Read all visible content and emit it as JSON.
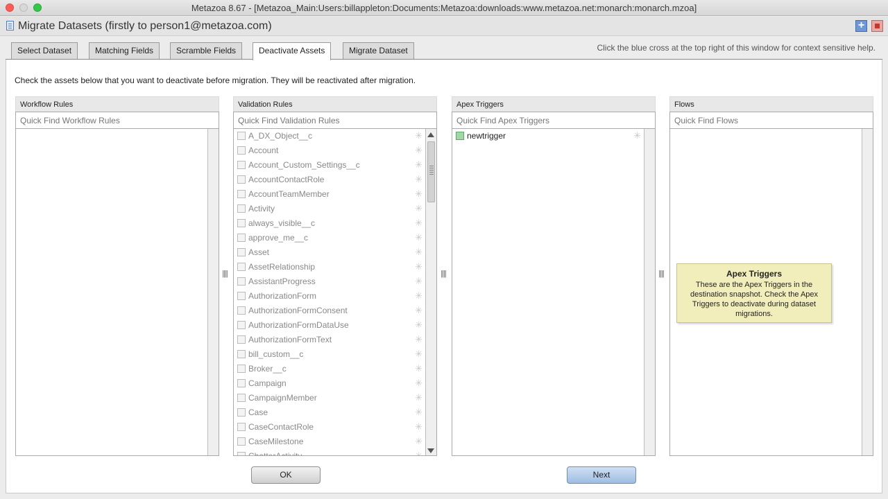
{
  "window": {
    "title": "Metazoa 8.67 - [Metazoa_Main:Users:billappleton:Documents:Metazoa:downloads:www.metazoa.net:monarch:monarch.mzoa]"
  },
  "dialog": {
    "title": "Migrate Datasets (firstly to person1@metazoa.com)",
    "help_button": "+"
  },
  "tabs": [
    {
      "label": "Select Dataset",
      "active": false
    },
    {
      "label": "Matching Fields",
      "active": false
    },
    {
      "label": "Scramble Fields",
      "active": false
    },
    {
      "label": "Deactivate Assets",
      "active": true
    },
    {
      "label": "Migrate Dataset",
      "active": false
    }
  ],
  "help_hint": "Click the blue cross at the top right of this window for context sensitive help.",
  "instructions": "Check the assets below that you want to deactivate before migration. They will be reactivated after migration.",
  "panels": {
    "workflow": {
      "title": "Workflow Rules",
      "placeholder": "Quick Find Workflow Rules"
    },
    "validation": {
      "title": "Validation Rules",
      "placeholder": "Quick Find Validation Rules",
      "items": [
        "A_DX_Object__c",
        "Account",
        "Account_Custom_Settings__c",
        "AccountContactRole",
        "AccountTeamMember",
        "Activity",
        "always_visible__c",
        "approve_me__c",
        "Asset",
        "AssetRelationship",
        "AssistantProgress",
        "AuthorizationForm",
        "AuthorizationFormConsent",
        "AuthorizationFormDataUse",
        "AuthorizationFormText",
        "bill_custom__c",
        "Broker__c",
        "Campaign",
        "CampaignMember",
        "Case",
        "CaseContactRole",
        "CaseMilestone",
        "ChatterActivity"
      ]
    },
    "apex": {
      "title": "Apex Triggers",
      "placeholder": "Quick Find Apex Triggers",
      "items": [
        "newtrigger"
      ]
    },
    "flows": {
      "title": "Flows",
      "placeholder": "Quick Find Flows"
    }
  },
  "tooltip": {
    "title": "Apex Triggers",
    "body": "These are the Apex Triggers in the destination snapshot. Check the Apex Triggers to deactivate during dataset migrations."
  },
  "buttons": {
    "ok": "OK",
    "next": "Next"
  },
  "icons": {
    "gear": "gear-icon",
    "splitter": "splitter-handle-icon"
  }
}
